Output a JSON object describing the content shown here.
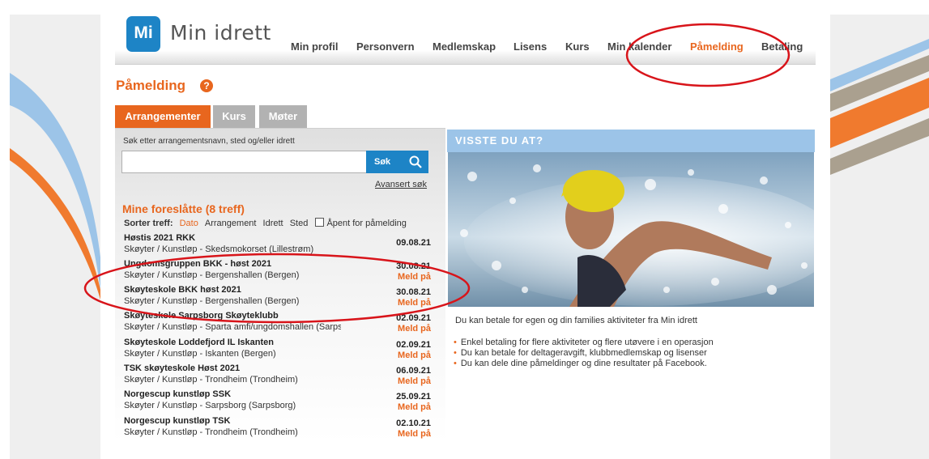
{
  "app": {
    "logo_mark": "Mi",
    "logo_text": "Min idrett"
  },
  "nav": {
    "items": [
      "Min profil",
      "Personvern",
      "Medlemskap",
      "Lisens",
      "Kurs",
      "Min kalender",
      "Påmelding",
      "Betaling"
    ],
    "active": "Påmelding"
  },
  "page": {
    "title": "Påmelding",
    "help": "?"
  },
  "tabs": [
    "Arrangementer",
    "Kurs",
    "Møter"
  ],
  "search": {
    "label": "Søk etter arrangementsnavn, sted og/eller idrett",
    "value": "",
    "button": "Søk",
    "advanced": "Avansert søk"
  },
  "suggestions": {
    "title": "Mine foreslåtte (8 treff)",
    "sort_label": "Sorter treff:",
    "sort_options": [
      "Dato",
      "Arrangement",
      "Idrett",
      "Sted"
    ],
    "sort_active": "Dato",
    "open_label": "Åpent for påmelding",
    "events": [
      {
        "name": "Høstis 2021 RKK",
        "location": "Skøyter / Kunstløp - Skedsmokorset (Lillestrøm)",
        "date": "09.08.21",
        "action": ""
      },
      {
        "name": "Ungdomsgruppen BKK - høst 2021",
        "location": "Skøyter / Kunstløp - Bergenshallen (Bergen)",
        "date": "30.08.21",
        "action": "Meld på"
      },
      {
        "name": "Skøyteskole BKK høst 2021",
        "location": "Skøyter / Kunstløp - Bergenshallen (Bergen)",
        "date": "30.08.21",
        "action": "Meld på"
      },
      {
        "name": "Skøyteskole Sarpsborg Skøyteklubb",
        "location": "Skøyter / Kunstløp - Sparta amfi/ungdomshallen (Sarpsborg)",
        "date": "02.09.21",
        "action": "Meld på"
      },
      {
        "name": "Skøyteskole Loddefjord IL Iskanten",
        "location": "Skøyter / Kunstløp - Iskanten (Bergen)",
        "date": "02.09.21",
        "action": "Meld på"
      },
      {
        "name": "TSK skøyteskole Høst 2021",
        "location": "Skøyter / Kunstløp - Trondheim (Trondheim)",
        "date": "06.09.21",
        "action": "Meld på"
      },
      {
        "name": "Norgescup kunstløp SSK",
        "location": "Skøyter / Kunstløp - Sarpsborg (Sarpsborg)",
        "date": "25.09.21",
        "action": "Meld på"
      },
      {
        "name": "Norgescup kunstløp TSK",
        "location": "Skøyter / Kunstløp - Trondheim (Trondheim)",
        "date": "02.10.21",
        "action": "Meld på"
      }
    ]
  },
  "info": {
    "heading": "VISSTE DU AT?",
    "intro": "Du kan betale for egen og din families aktiviteter fra Min idrett",
    "bullets": [
      "Enkel betaling for flere aktiviteter og flere utøvere i en operasjon",
      "Du kan betale for deltageravgift, klubbmedlemskap og lisenser",
      "Du kan dele dine påmeldinger og dine resultater på Facebook."
    ]
  },
  "colors": {
    "brand_blue": "#1d84c6",
    "accent_orange": "#e8661e",
    "annotation_red": "#d8141a"
  }
}
